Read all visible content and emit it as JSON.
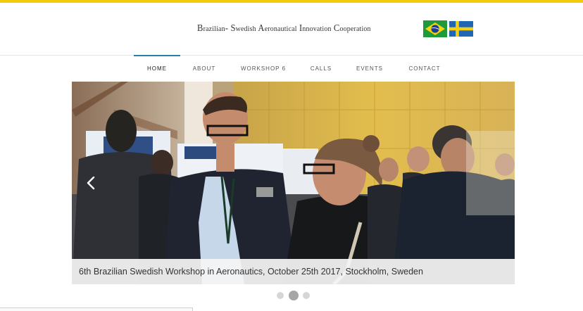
{
  "header": {
    "title_parts": [
      "B",
      "razilian",
      "-",
      " S",
      "wedish",
      " A",
      "eronautical",
      " I",
      "nnovation",
      " C",
      "ooperation"
    ],
    "flags": [
      "brazil-flag-icon",
      "sweden-flag-icon"
    ]
  },
  "nav": {
    "items": [
      {
        "label": "Home",
        "active": true
      },
      {
        "label": "About",
        "active": false
      },
      {
        "label": "Workshop 6",
        "active": false
      },
      {
        "label": "Calls",
        "active": false
      },
      {
        "label": "Events",
        "active": false
      },
      {
        "label": "Contact",
        "active": false
      }
    ],
    "accent": "#2a7fa6"
  },
  "slider": {
    "caption": "6th Brazilian Swedish Workshop in Aeronautics, October 25th 2017, Stockholm, Sweden",
    "prev_icon": "chevron-left-icon",
    "slide_count": 3,
    "active_slide": 2
  },
  "colors": {
    "top_bar": "#f2cc0c",
    "text": "#333333"
  }
}
